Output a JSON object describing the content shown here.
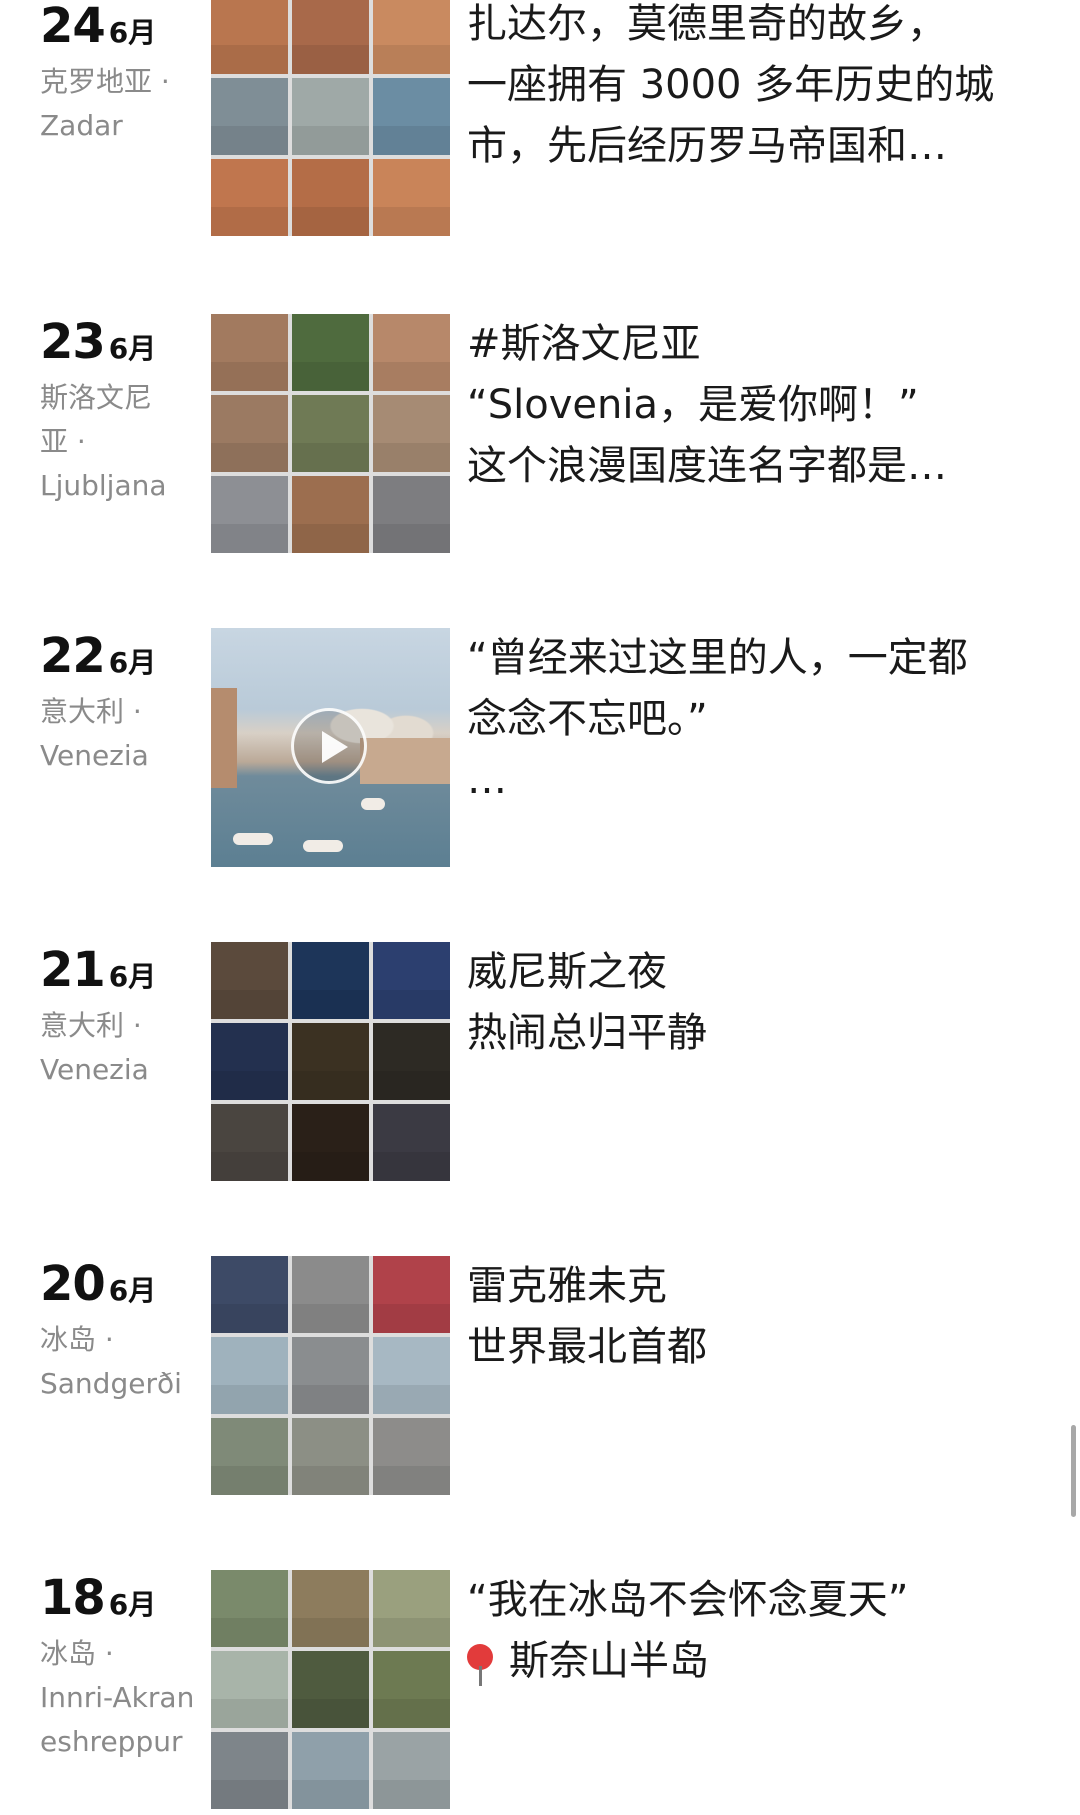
{
  "posts": [
    {
      "day": "24",
      "month": "6月",
      "location": [
        "克罗地亚 ·",
        "Zadar"
      ],
      "media": "grid",
      "tiles": [
        "#b9764f",
        "#a8694a",
        "#c98a60",
        "#7f8e96",
        "#9fa9a7",
        "#6b8da3",
        "#c0764e",
        "#b46d47",
        "#c98459"
      ],
      "caption": [
        "扎达尔，莫德里奇的故乡，",
        "一座拥有 3000 多年历史的城",
        "市，先后经历罗马帝国和…"
      ]
    },
    {
      "day": "23",
      "month": "6月",
      "location": [
        "斯洛文尼",
        "亚 ·",
        "Ljubljana"
      ],
      "media": "grid",
      "tiles": [
        "#a27a5f",
        "#4f6b3e",
        "#b7886a",
        "#9b7a62",
        "#6f7a55",
        "#a68b74",
        "#8d8f94",
        "#9c6e4f",
        "#7d7d80"
      ],
      "caption": [
        "#斯洛文尼亚",
        "“Slovenia，是爱你啊！”",
        "这个浪漫国度连名字都是…"
      ]
    },
    {
      "day": "22",
      "month": "6月",
      "location": [
        "意大利 ·",
        "Venezia"
      ],
      "media": "video",
      "caption": [
        "“曾经来过这里的人，一定都",
        "念念不忘吧。”",
        "…"
      ]
    },
    {
      "day": "21",
      "month": "6月",
      "location": [
        "意大利 ·",
        "Venezia"
      ],
      "media": "grid",
      "tiles": [
        "#5b4a3c",
        "#1d3559",
        "#2c3f6f",
        "#23304f",
        "#3b3122",
        "#2d2a24",
        "#4a4540",
        "#2a2018",
        "#3b3a43"
      ],
      "caption": [
        "威尼斯之夜",
        "热闹总归平静"
      ]
    },
    {
      "day": "20",
      "month": "6月",
      "location": [
        "冰岛 ·",
        "Sandgerði"
      ],
      "media": "grid",
      "tiles": [
        "#3d4a66",
        "#8b8b8b",
        "#b0424a",
        "#9fb2bd",
        "#8a8d8f",
        "#a7b8c3",
        "#7f8a78",
        "#8c8f85",
        "#8d8c8a"
      ],
      "caption": [
        "雷克雅未克",
        "世界最北首都"
      ]
    },
    {
      "day": "18",
      "month": "6月",
      "location": [
        "冰岛 ·",
        "Innri-Akran",
        "eshreppur"
      ],
      "media": "grid",
      "tiles": [
        "#7a8a6b",
        "#8d7c5d",
        "#9aa07e",
        "#a8b4a9",
        "#4f5b3f",
        "#6d7a52",
        "#7e858a",
        "#8fa0aa",
        "#9aa3a5"
      ],
      "caption": [
        "“我在冰岛不会怀念夏天”",
        "",
        "斯奈山半岛"
      ],
      "pin_line": 2
    }
  ]
}
